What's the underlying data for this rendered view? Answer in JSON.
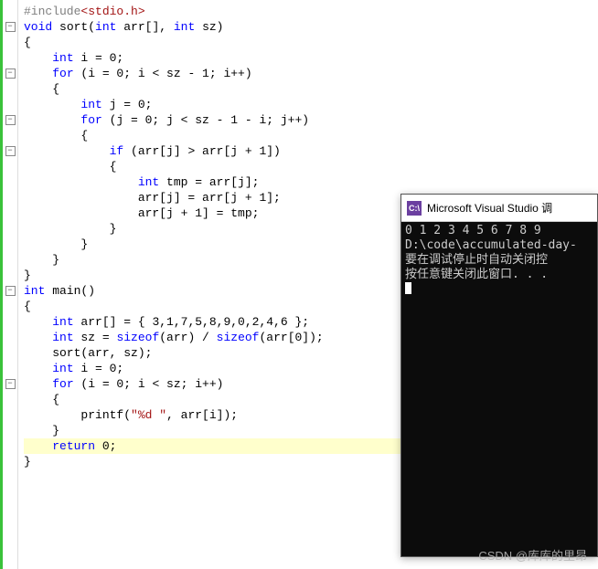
{
  "code": {
    "lines": [
      {
        "fold": null,
        "segs": [
          {
            "c": "pp",
            "t": "#include"
          },
          {
            "c": "inc",
            "t": "<stdio.h>"
          }
        ]
      },
      {
        "fold": "-",
        "segs": [
          {
            "c": "kw",
            "t": "void"
          },
          {
            "c": "id",
            "t": " sort("
          },
          {
            "c": "kw",
            "t": "int"
          },
          {
            "c": "id",
            "t": " arr[], "
          },
          {
            "c": "kw",
            "t": "int"
          },
          {
            "c": "id",
            "t": " sz)"
          }
        ]
      },
      {
        "fold": null,
        "segs": [
          {
            "c": "id",
            "t": "{"
          }
        ]
      },
      {
        "fold": null,
        "segs": [
          {
            "c": "id",
            "t": "    "
          },
          {
            "c": "kw",
            "t": "int"
          },
          {
            "c": "id",
            "t": " i = 0;"
          }
        ]
      },
      {
        "fold": "-",
        "segs": [
          {
            "c": "id",
            "t": "    "
          },
          {
            "c": "kw",
            "t": "for"
          },
          {
            "c": "id",
            "t": " (i = 0; i < sz - 1; i++)"
          }
        ]
      },
      {
        "fold": null,
        "segs": [
          {
            "c": "id",
            "t": "    {"
          }
        ]
      },
      {
        "fold": null,
        "segs": [
          {
            "c": "id",
            "t": "        "
          },
          {
            "c": "kw",
            "t": "int"
          },
          {
            "c": "id",
            "t": " j = 0;"
          }
        ]
      },
      {
        "fold": "-",
        "segs": [
          {
            "c": "id",
            "t": "        "
          },
          {
            "c": "kw",
            "t": "for"
          },
          {
            "c": "id",
            "t": " (j = 0; j < sz - 1 - i; j++)"
          }
        ]
      },
      {
        "fold": null,
        "segs": [
          {
            "c": "id",
            "t": "        {"
          }
        ]
      },
      {
        "fold": "-",
        "segs": [
          {
            "c": "id",
            "t": "            "
          },
          {
            "c": "kw",
            "t": "if"
          },
          {
            "c": "id",
            "t": " (arr[j] > arr[j + 1])"
          }
        ]
      },
      {
        "fold": null,
        "segs": [
          {
            "c": "id",
            "t": "            {"
          }
        ]
      },
      {
        "fold": null,
        "segs": [
          {
            "c": "id",
            "t": "                "
          },
          {
            "c": "kw",
            "t": "int"
          },
          {
            "c": "id",
            "t": " tmp = arr[j];"
          }
        ]
      },
      {
        "fold": null,
        "segs": [
          {
            "c": "id",
            "t": "                arr[j] = arr[j + 1];"
          }
        ]
      },
      {
        "fold": null,
        "segs": [
          {
            "c": "id",
            "t": "                arr[j + 1] = tmp;"
          }
        ]
      },
      {
        "fold": null,
        "segs": [
          {
            "c": "id",
            "t": "            }"
          }
        ]
      },
      {
        "fold": null,
        "segs": [
          {
            "c": "id",
            "t": "        }"
          }
        ]
      },
      {
        "fold": null,
        "segs": [
          {
            "c": "id",
            "t": "    }"
          }
        ]
      },
      {
        "fold": null,
        "segs": [
          {
            "c": "id",
            "t": "}"
          }
        ]
      },
      {
        "fold": "-",
        "segs": [
          {
            "c": "kw",
            "t": "int"
          },
          {
            "c": "id",
            "t": " main()"
          }
        ]
      },
      {
        "fold": null,
        "segs": [
          {
            "c": "id",
            "t": "{"
          }
        ]
      },
      {
        "fold": null,
        "segs": [
          {
            "c": "id",
            "t": "    "
          },
          {
            "c": "kw",
            "t": "int"
          },
          {
            "c": "id",
            "t": " arr[] = { 3,1,7,5,8,9,0,2,4,6 };"
          }
        ]
      },
      {
        "fold": null,
        "segs": [
          {
            "c": "id",
            "t": "    "
          },
          {
            "c": "kw",
            "t": "int"
          },
          {
            "c": "id",
            "t": " sz = "
          },
          {
            "c": "kw",
            "t": "sizeof"
          },
          {
            "c": "id",
            "t": "(arr) / "
          },
          {
            "c": "kw",
            "t": "sizeof"
          },
          {
            "c": "id",
            "t": "(arr[0]);"
          }
        ]
      },
      {
        "fold": null,
        "segs": [
          {
            "c": "id",
            "t": "    sort(arr, sz);"
          }
        ]
      },
      {
        "fold": null,
        "segs": [
          {
            "c": "id",
            "t": "    "
          },
          {
            "c": "kw",
            "t": "int"
          },
          {
            "c": "id",
            "t": " i = 0;"
          }
        ]
      },
      {
        "fold": "-",
        "segs": [
          {
            "c": "id",
            "t": "    "
          },
          {
            "c": "kw",
            "t": "for"
          },
          {
            "c": "id",
            "t": " (i = 0; i < sz; i++)"
          }
        ]
      },
      {
        "fold": null,
        "segs": [
          {
            "c": "id",
            "t": "    {"
          }
        ]
      },
      {
        "fold": null,
        "segs": [
          {
            "c": "id",
            "t": "        printf("
          },
          {
            "c": "str",
            "t": "\"%d \""
          },
          {
            "c": "id",
            "t": ", arr[i]);"
          }
        ]
      },
      {
        "fold": null,
        "segs": [
          {
            "c": "id",
            "t": "    }"
          }
        ]
      },
      {
        "fold": null,
        "hl": true,
        "segs": [
          {
            "c": "id",
            "t": "    "
          },
          {
            "c": "kw",
            "t": "return"
          },
          {
            "c": "id",
            "t": " 0;"
          }
        ]
      },
      {
        "fold": null,
        "segs": [
          {
            "c": "id",
            "t": "}"
          }
        ]
      }
    ]
  },
  "console": {
    "icon_text": "C:\\",
    "title": "Microsoft Visual Studio 调",
    "lines": [
      "0 1 2 3 4 5 6 7 8 9",
      "D:\\code\\accumulated-day-",
      "要在调试停止时自动关闭控",
      "按任意键关闭此窗口. . ."
    ]
  },
  "watermark": "CSDN @库库的里昂"
}
